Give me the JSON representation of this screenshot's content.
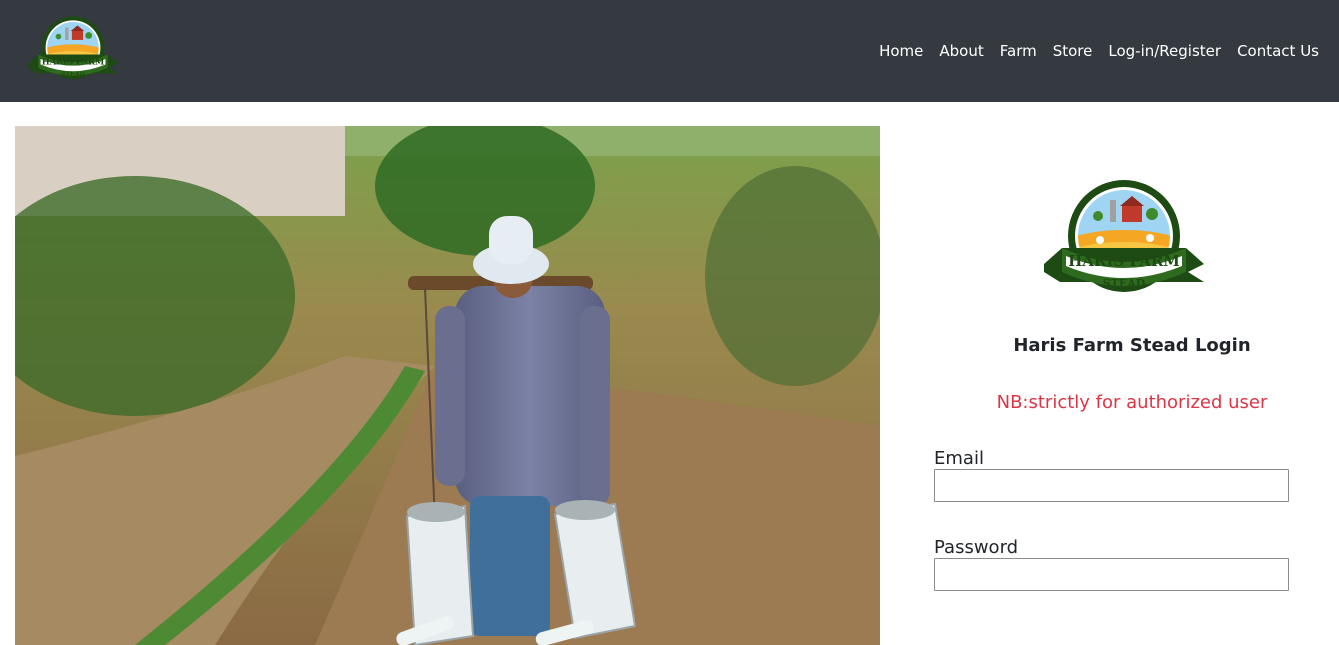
{
  "nav": {
    "logo": {
      "top_text": "HARIS FARM",
      "bottom_text": "STEAD"
    },
    "links": [
      "Home",
      "About",
      "Farm",
      "Store",
      "Log-in/Register",
      "Contact Us"
    ]
  },
  "login": {
    "logo": {
      "top_text": "HARIS FARM",
      "bottom_text": "STEAD"
    },
    "title": "Haris Farm Stead Login",
    "note": "NB:strictly for authorized user",
    "email": {
      "label": "Email",
      "value": "",
      "placeholder": ""
    },
    "password": {
      "label": "Password",
      "value": "",
      "placeholder": ""
    }
  },
  "colors": {
    "navbar": "#343a40",
    "note": "#dc3545",
    "logo_green": "#2c5e1a",
    "logo_orange": "#f5a623"
  }
}
